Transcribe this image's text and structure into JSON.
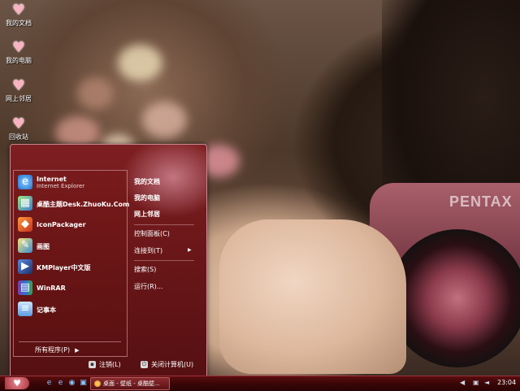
{
  "desktop_icons": [
    {
      "label": "我的文档",
      "icon": "heart-icon"
    },
    {
      "label": "我的电脑",
      "icon": "heart-icon"
    },
    {
      "label": "网上邻居",
      "icon": "heart-icon"
    },
    {
      "label": "回收站",
      "icon": "heart-icon"
    }
  ],
  "wallpaper": {
    "brand": "PENTAX"
  },
  "start_menu": {
    "pinned": {
      "name": "Internet",
      "subtitle": "Internet Explorer",
      "icon": "ie-icon"
    },
    "programs": [
      {
        "label": "桌酷主题Desk.ZhuoKu.Com",
        "icon": "theme-icon"
      },
      {
        "label": "IconPackager",
        "icon": "iconpackager-icon"
      },
      {
        "label": "画图",
        "icon": "paint-icon"
      },
      {
        "label": "KMPlayer中文版",
        "icon": "kmplayer-icon"
      },
      {
        "label": "WinRAR",
        "icon": "winrar-icon"
      },
      {
        "label": "记事本",
        "icon": "notepad-icon"
      }
    ],
    "all_programs": "所有程序(P)",
    "right_items": {
      "my_documents": "我的文档",
      "my_computer": "我的电脑",
      "network": "网上邻居",
      "control_panel": "控制面板(C)",
      "connect_to": "连接到(T)",
      "search": "搜索(S)",
      "run": "运行(R)..."
    },
    "footer": {
      "logoff": "注销(L)",
      "shutdown": "关闭计算机(U)"
    }
  },
  "taskbar": {
    "task_label": "桌面 - 壁纸 - 桌酷壁...",
    "clock": "23:04"
  },
  "colors": {
    "accent": "#6b1719",
    "taskbar": "#3a0607",
    "heart": "#f7b3c2"
  }
}
